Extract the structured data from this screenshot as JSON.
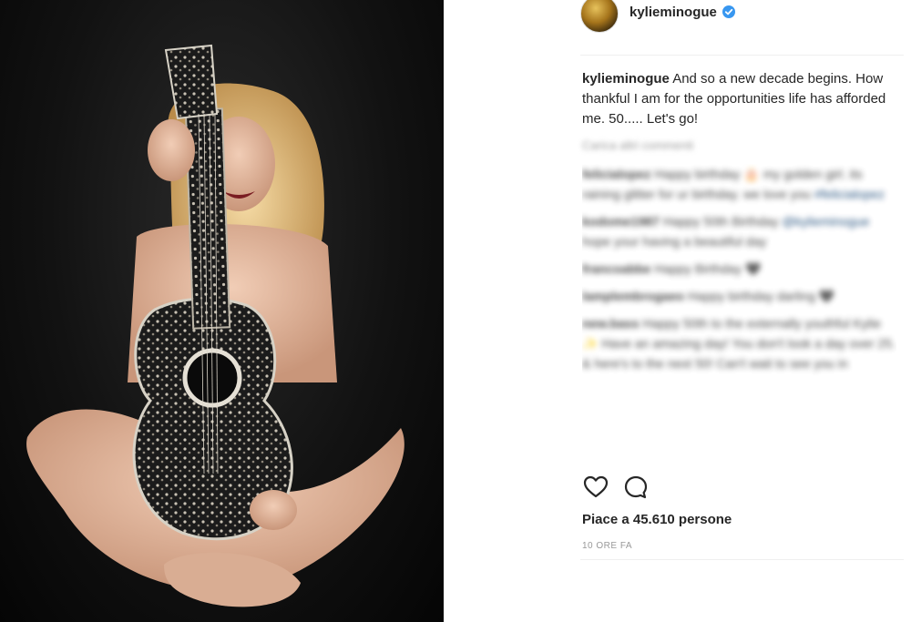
{
  "post": {
    "image_alt": "Kylie Minogue holding a jeweled guitar",
    "username": "kylieminogue",
    "caption": {
      "user": "kylieminogue",
      "text": "And so a new decade begins. How thankful I am for the opportunities life has afforded me. 50..... Let's go!"
    },
    "load_more": "Carica altri commenti",
    "comments": [
      {
        "user": "felicialopez",
        "text": "Happy birthday 🎂 my golden girl. its raining glitter for ur birthday. we love you",
        "mention": "#felicialopez"
      },
      {
        "user": "kodome1987",
        "text": "Happy 50th Birthday",
        "mention": "@kylieminogue",
        "text2": "hope your having a beautiful day"
      },
      {
        "user": "francoabbe",
        "text": "Happy Birthday 🖤"
      },
      {
        "user": "lamplembrogaeo",
        "text": "Happy birthday darling 🖤"
      },
      {
        "user": "new.bass",
        "text": "Happy 50th to the externally youthful Kylie ✨ Have an amazing day! You don't look a day over 25. & here's to the next 50! Can't wait to see you in"
      }
    ],
    "likes": "Piace a 45.610 persone",
    "time": "10 ORE FA",
    "icons": {
      "like": "heart-icon",
      "comment": "comment-icon",
      "verified": "verified-badge-icon"
    },
    "colors": {
      "verified": "#3897f0",
      "text": "#262626",
      "muted": "#999999"
    }
  }
}
